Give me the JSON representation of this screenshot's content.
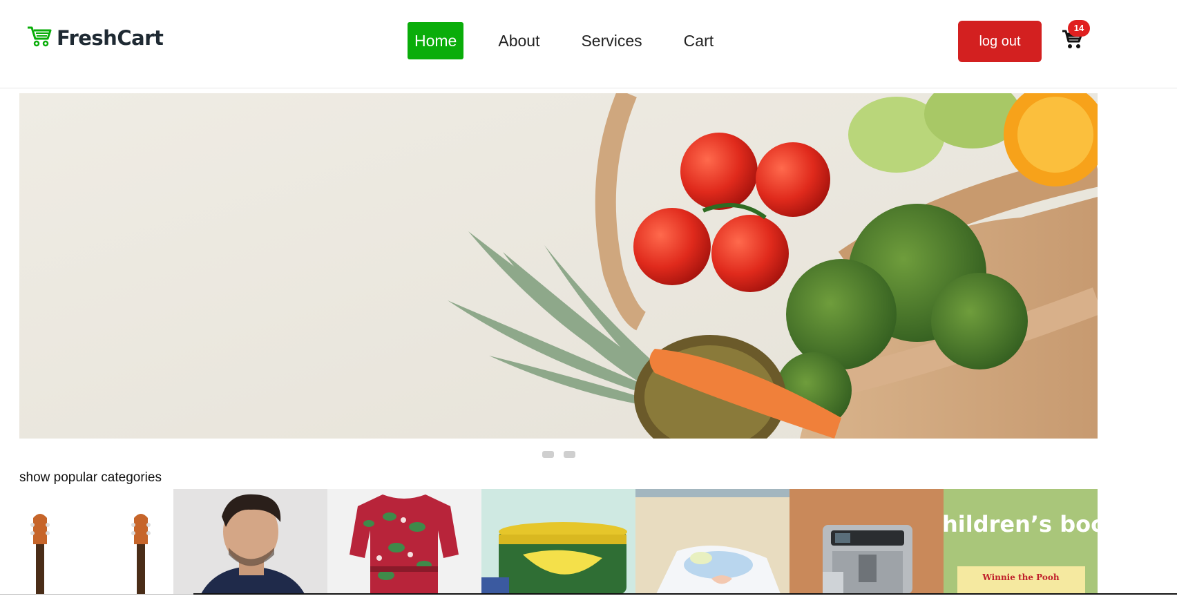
{
  "brand": {
    "name": "FreshCart",
    "icon": "shopping-cart-icon",
    "color": "#0aad0a"
  },
  "nav": {
    "links": [
      {
        "label": "Home",
        "active": true
      },
      {
        "label": "About",
        "active": false
      },
      {
        "label": "Services",
        "active": false
      },
      {
        "label": "Cart",
        "active": false
      }
    ]
  },
  "header": {
    "logout_label": "log out",
    "cart_icon": "shopping-cart-icon",
    "cart_count": "14"
  },
  "slider": {
    "image": "fresh-produce-in-bag",
    "slides": 2
  },
  "categories": {
    "title": "show popular categories",
    "items": [
      {
        "image": "guitars",
        "bg": "#ffffff"
      },
      {
        "image": "man-portrait",
        "bg": "#e6e6e6"
      },
      {
        "image": "floral-dress",
        "bg": "#f2f2f2"
      },
      {
        "image": "canned-food",
        "bg": "#cfe9e2"
      },
      {
        "image": "baby-diapers",
        "bg": "#e8dcc0"
      },
      {
        "image": "coffee-machine",
        "bg": "#c9895a"
      },
      {
        "image": "childrens-books",
        "bg": "#a9c67a",
        "overlay_text": "hildren’s book",
        "cover_text": "Winnie the Pooh"
      }
    ]
  },
  "colors": {
    "accent": "#0aad0a",
    "danger": "#d32020"
  }
}
